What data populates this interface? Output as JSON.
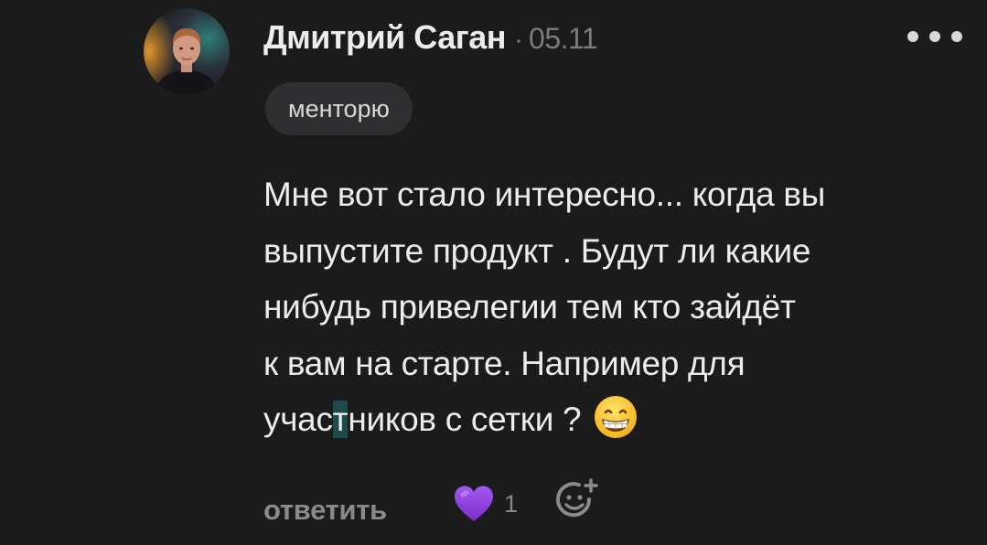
{
  "comment": {
    "author": "Дмитрий Саган",
    "separator": "·",
    "date": "05.11",
    "badge": "менторю",
    "text_lines": [
      "Мне вот стало интересно... когда вы",
      "выпустите продукт . Будут ли какие",
      "нибудь привелегии тем кто зайдёт",
      "к вам на старте. Например для"
    ],
    "last_line": {
      "before": "учас",
      "highlighted": "т",
      "after": "ников с сетки ?"
    },
    "emoji": "grinning-face-emoji"
  },
  "actions": {
    "reply_label": "ответить",
    "like_count": "1",
    "like_icon": "purple-heart-icon",
    "add_reaction_icon": "add-reaction-icon",
    "more_icon": "more-dots-icon"
  },
  "colors": {
    "background": "#1b1b1c",
    "text": "#ececec",
    "muted": "#7c7c7c",
    "badge_bg": "#2f2f31",
    "heart": "#8e3dd9",
    "highlight": "#1d4a4a"
  }
}
